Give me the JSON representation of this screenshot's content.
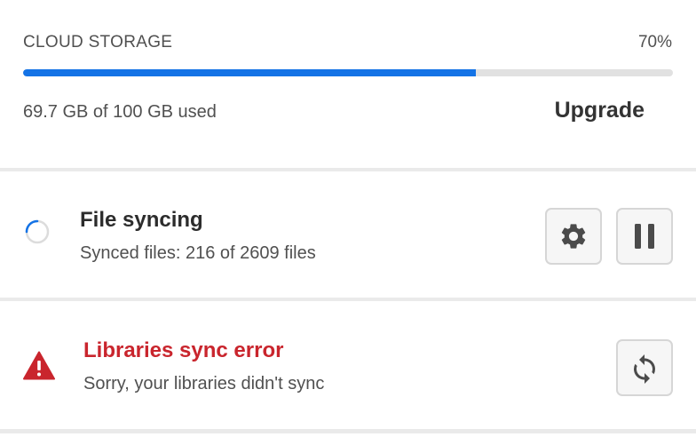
{
  "storage": {
    "label": "CLOUD STORAGE",
    "percent_label": "70%",
    "usage_fraction": 0.697,
    "used_text": "69.7 GB of 100 GB used",
    "upgrade_label": "Upgrade",
    "bar_color": "#1473e6",
    "track_color": "#e1e1e1"
  },
  "file_sync": {
    "title": "File syncing",
    "status": "Synced files: 216 of 2609 files",
    "icons": [
      "spinner-icon",
      "gear-icon",
      "pause-icon"
    ]
  },
  "libraries": {
    "title": "Libraries sync error",
    "message": "Sorry, your libraries didn't sync",
    "error_color": "#c9252d",
    "icons": [
      "warning-icon",
      "refresh-icon"
    ]
  }
}
